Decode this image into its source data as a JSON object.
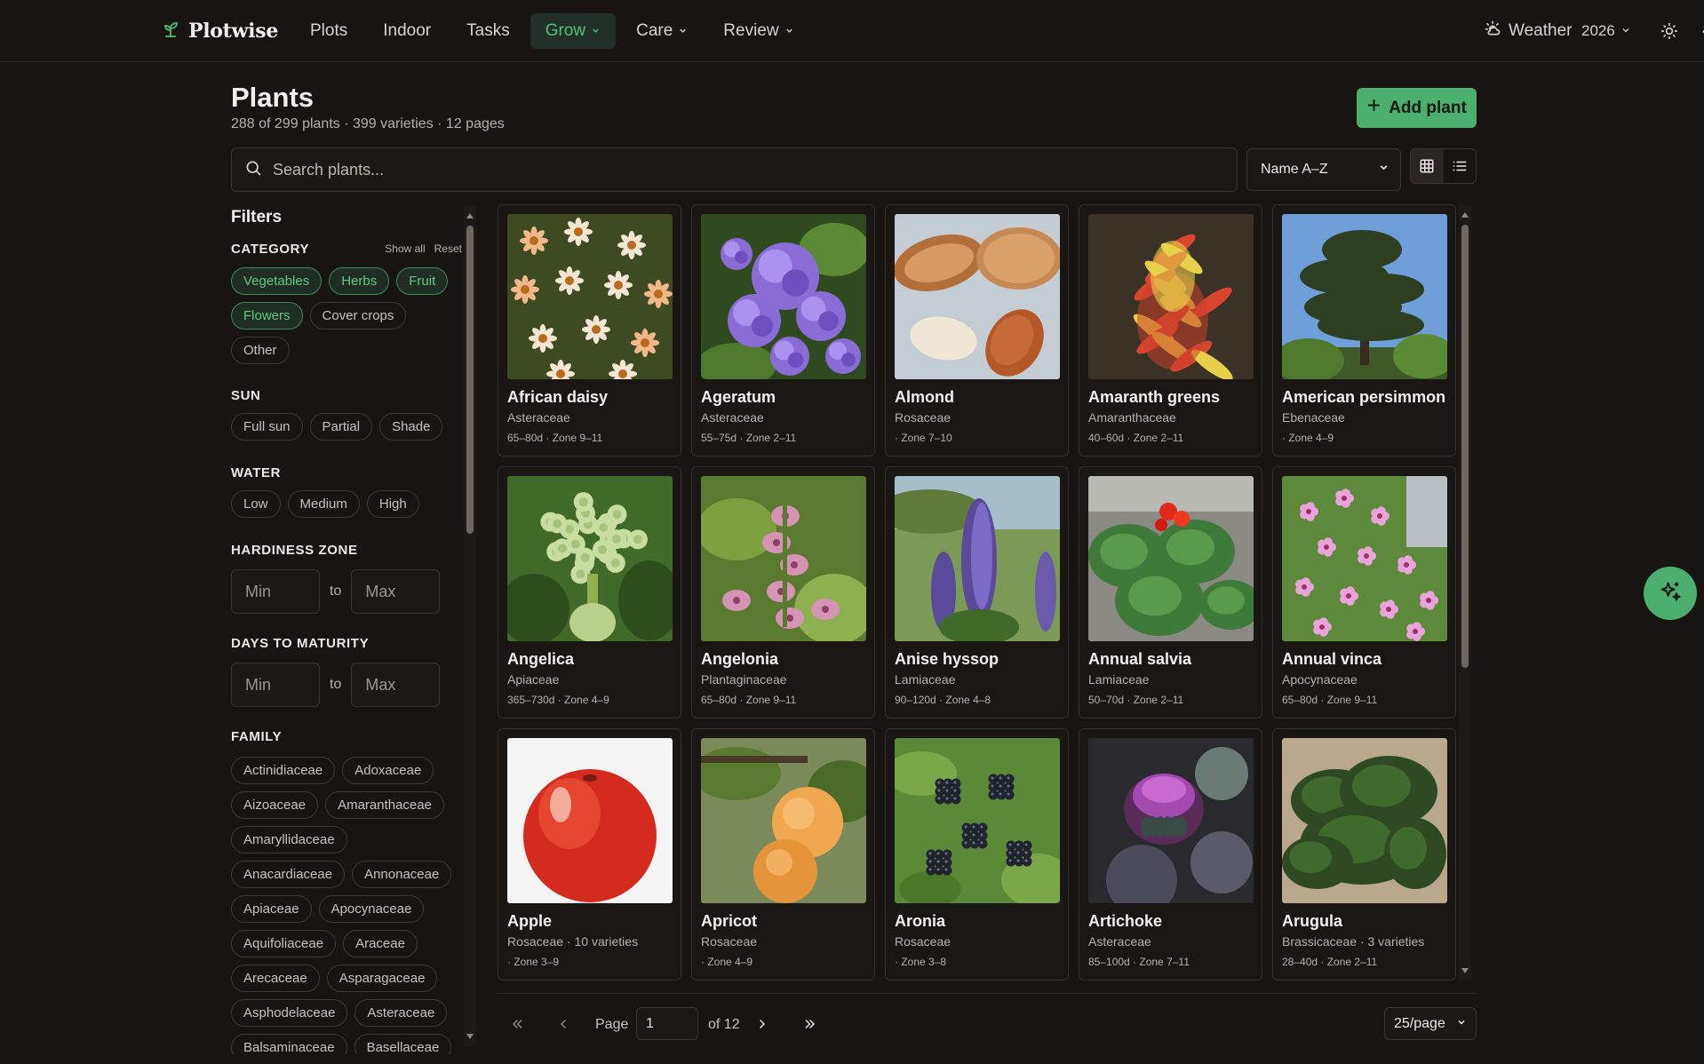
{
  "app": {
    "name": "Plotwise"
  },
  "nav": {
    "items": [
      {
        "label": "Plots",
        "dropdown": false,
        "active": false
      },
      {
        "label": "Indoor",
        "dropdown": false,
        "active": false
      },
      {
        "label": "Tasks",
        "dropdown": false,
        "active": false
      },
      {
        "label": "Grow",
        "dropdown": true,
        "active": true
      },
      {
        "label": "Care",
        "dropdown": true,
        "active": false
      },
      {
        "label": "Review",
        "dropdown": true,
        "active": false
      }
    ],
    "weather_label": "Weather",
    "year": "2026"
  },
  "page": {
    "title": "Plants",
    "subtitle": "288 of 299 plants · 399 varieties · 12 pages",
    "add_label": "Add plant",
    "search_placeholder": "Search plants...",
    "sort_value": "Name A–Z"
  },
  "filters": {
    "title": "Filters",
    "category": {
      "heading": "CATEGORY",
      "show_all": "Show all",
      "reset": "Reset",
      "chips": [
        {
          "label": "Vegetables",
          "selected": true
        },
        {
          "label": "Herbs",
          "selected": true
        },
        {
          "label": "Fruit",
          "selected": true
        },
        {
          "label": "Flowers",
          "selected": true
        },
        {
          "label": "Cover crops",
          "selected": false
        },
        {
          "label": "Other",
          "selected": false
        }
      ]
    },
    "sun": {
      "heading": "SUN",
      "chips": [
        "Full sun",
        "Partial",
        "Shade"
      ]
    },
    "water": {
      "heading": "WATER",
      "chips": [
        "Low",
        "Medium",
        "High"
      ]
    },
    "zone": {
      "heading": "HARDINESS ZONE",
      "min_placeholder": "Min",
      "max_placeholder": "Max",
      "to": "to"
    },
    "maturity": {
      "heading": "DAYS TO MATURITY",
      "min_placeholder": "Min",
      "max_placeholder": "Max",
      "to": "to"
    },
    "family": {
      "heading": "FAMILY",
      "chips": [
        "Actinidiaceae",
        "Adoxaceae",
        "Aizoaceae",
        "Amaranthaceae",
        "Amaryllidaceae",
        "Anacardiaceae",
        "Annonaceae",
        "Apiaceae",
        "Apocynaceae",
        "Aquifoliaceae",
        "Araceae",
        "Arecaceae",
        "Asparagaceae",
        "Asphodelaceae",
        "Asteraceae",
        "Balsaminaceae",
        "Basellaceae"
      ]
    }
  },
  "plants": [
    {
      "name": "African daisy",
      "family": "Asteraceae",
      "meta": "65–80d · Zone 9–11",
      "photo": "daisy"
    },
    {
      "name": "Ageratum",
      "family": "Asteraceae",
      "meta": "55–75d · Zone 2–11",
      "photo": "ageratum"
    },
    {
      "name": "Almond",
      "family": "Rosaceae",
      "meta": "· Zone 7–10",
      "photo": "almond"
    },
    {
      "name": "Amaranth greens",
      "family": "Amaranthaceae",
      "meta": "40–60d · Zone 2–11",
      "photo": "amaranth"
    },
    {
      "name": "American persimmon",
      "family": "Ebenaceae",
      "meta": "· Zone 4–9",
      "photo": "tree"
    },
    {
      "name": "Angelica",
      "family": "Apiaceae",
      "meta": "365–730d · Zone 4–9",
      "photo": "angelica"
    },
    {
      "name": "Angelonia",
      "family": "Plantaginaceae",
      "meta": "65–80d · Zone 9–11",
      "photo": "angelonia"
    },
    {
      "name": "Anise hyssop",
      "family": "Lamiaceae",
      "meta": "90–120d · Zone 4–8",
      "photo": "hyssop"
    },
    {
      "name": "Annual salvia",
      "family": "Lamiaceae",
      "meta": "50–70d · Zone 2–11",
      "photo": "salvia"
    },
    {
      "name": "Annual vinca",
      "family": "Apocynaceae",
      "meta": "65–80d · Zone 9–11",
      "photo": "vinca"
    },
    {
      "name": "Apple",
      "family": "Rosaceae · 10 varieties",
      "meta": "· Zone 3–9",
      "photo": "apple"
    },
    {
      "name": "Apricot",
      "family": "Rosaceae",
      "meta": "· Zone 4–9",
      "photo": "apricot"
    },
    {
      "name": "Aronia",
      "family": "Rosaceae",
      "meta": "· Zone 3–8",
      "photo": "aronia"
    },
    {
      "name": "Artichoke",
      "family": "Asteraceae",
      "meta": "85–100d · Zone 7–11",
      "photo": "artichoke"
    },
    {
      "name": "Arugula",
      "family": "Brassicaceae · 3 varieties",
      "meta": "28–40d · Zone 2–11",
      "photo": "arugula"
    }
  ],
  "pagination": {
    "page_label": "Page",
    "current": "1",
    "of_label": "of 12",
    "per_page": "25/page"
  },
  "colors": {
    "accent": "#4caf6d",
    "background": "#181412",
    "card": "#1a1614"
  }
}
